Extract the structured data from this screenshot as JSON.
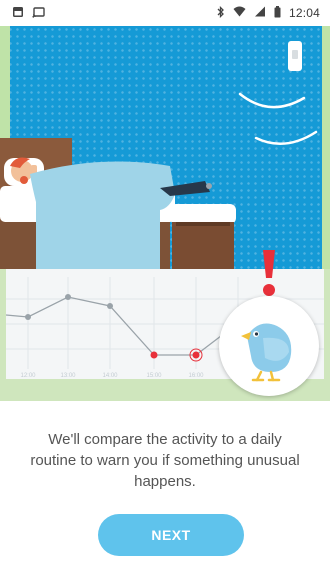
{
  "status_bar": {
    "time": "12:04",
    "left_icons": [
      "gallery-icon",
      "cast-icon"
    ],
    "right_icons": [
      "bluetooth-icon",
      "wifi-icon",
      "signal-icon",
      "battery-icon"
    ]
  },
  "chart": {
    "x_labels": [
      "12:00",
      "13:00",
      "14:00",
      "15:00",
      "16:00"
    ]
  },
  "onboarding": {
    "message": "We'll compare the activity to a daily routine to warn you if something unusual happens.",
    "next_label": "NEXT"
  },
  "colors": {
    "wall": "#159ad6",
    "button": "#5fc3ec",
    "alert": "#e8303a",
    "floor": "#cfe6bd"
  }
}
